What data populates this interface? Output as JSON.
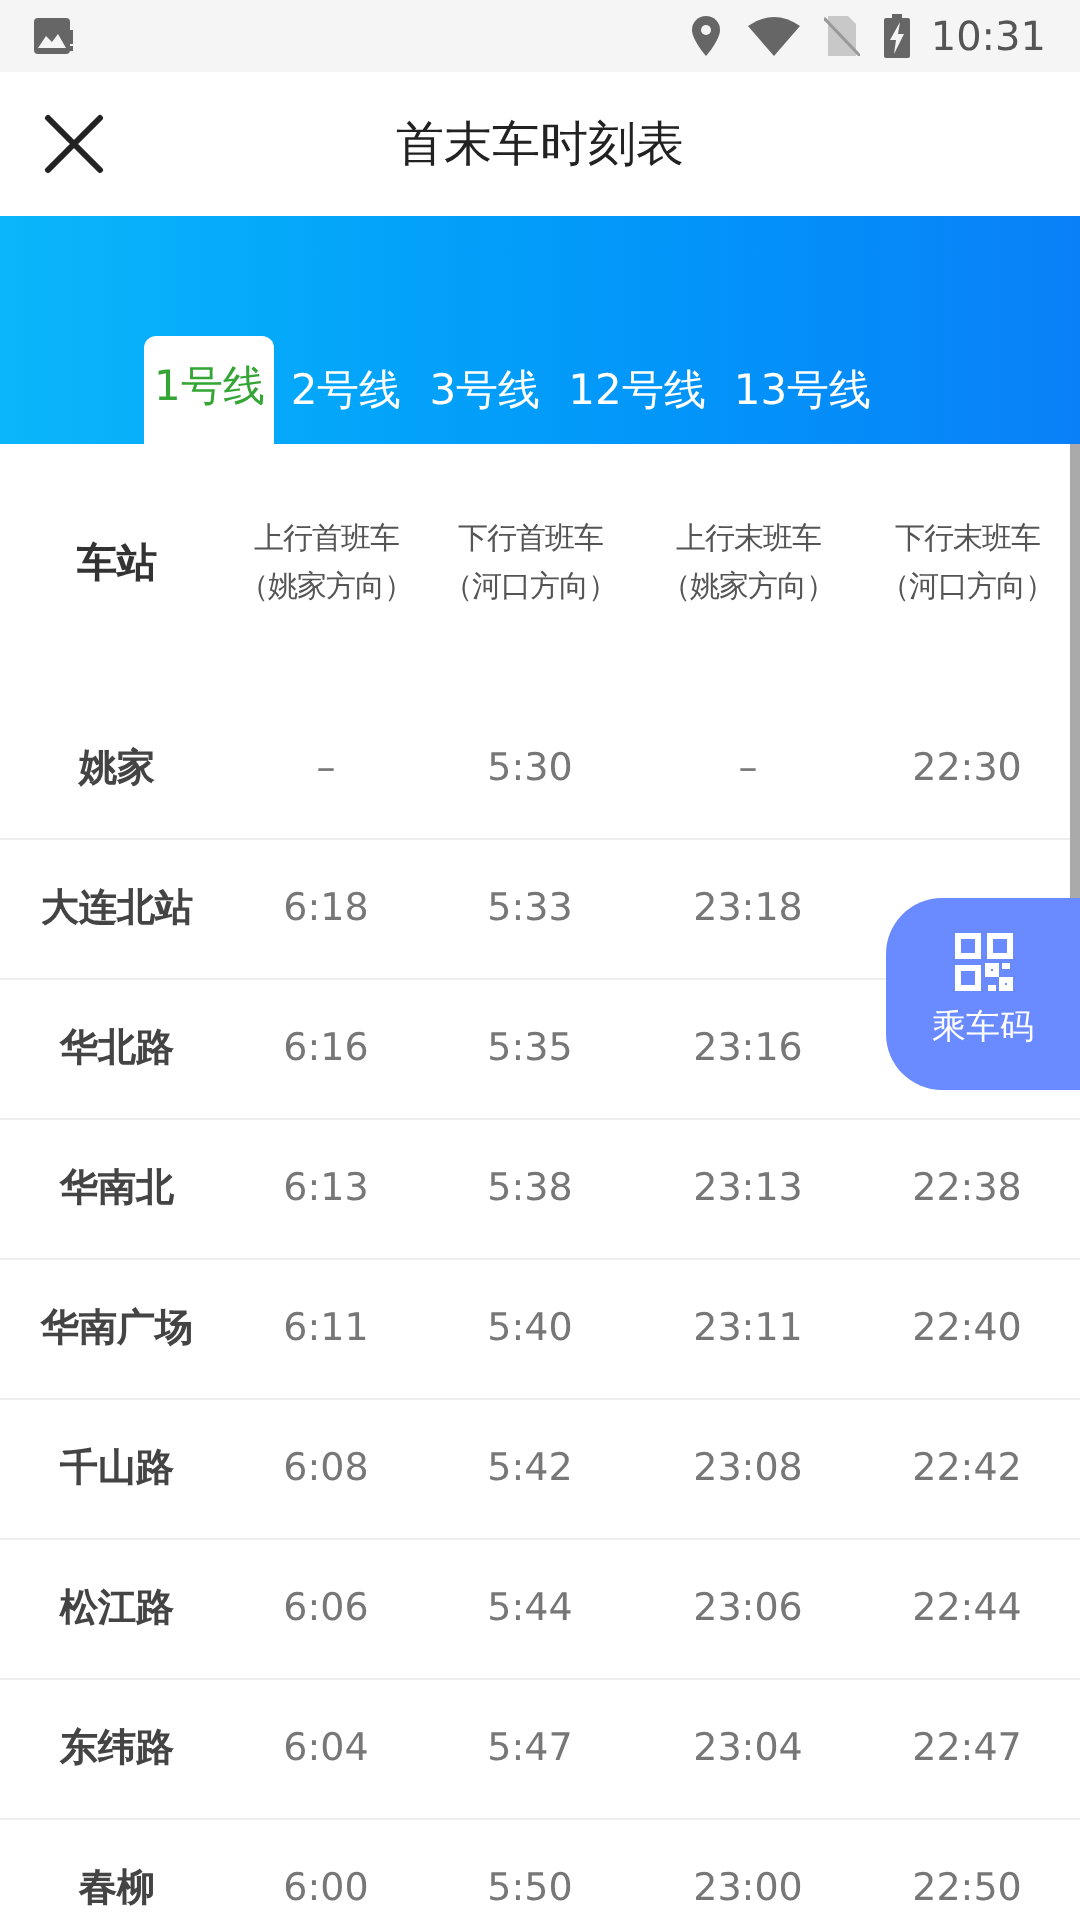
{
  "status_bar": {
    "time": "10:31"
  },
  "header": {
    "title": "首末车时刻表"
  },
  "tabs": [
    {
      "label": "1号线",
      "selected": true
    },
    {
      "label": "2号线",
      "selected": false
    },
    {
      "label": "3号线",
      "selected": false
    },
    {
      "label": "12号线",
      "selected": false
    },
    {
      "label": "13号线",
      "selected": false
    }
  ],
  "table": {
    "columns": [
      {
        "title": "车站"
      },
      {
        "title": "上行首班车",
        "subtitle": "（姚家方向）"
      },
      {
        "title": "下行首班车",
        "subtitle": "（河口方向）"
      },
      {
        "title": "上行末班车",
        "subtitle": "（姚家方向）"
      },
      {
        "title": "下行末班车",
        "subtitle": "（河口方向）"
      }
    ],
    "rows": [
      {
        "station": "姚家",
        "times": [
          "–",
          "5:30",
          "–",
          "22:30"
        ]
      },
      {
        "station": "大连北站",
        "times": [
          "6:18",
          "5:33",
          "23:18"
        ]
      },
      {
        "station": "华北路",
        "times": [
          "6:16",
          "5:35",
          "23:16"
        ]
      },
      {
        "station": "华南北",
        "times": [
          "6:13",
          "5:38",
          "23:13",
          "22:38"
        ]
      },
      {
        "station": "华南广场",
        "times": [
          "6:11",
          "5:40",
          "23:11",
          "22:40"
        ]
      },
      {
        "station": "千山路",
        "times": [
          "6:08",
          "5:42",
          "23:08",
          "22:42"
        ]
      },
      {
        "station": "松江路",
        "times": [
          "6:06",
          "5:44",
          "23:06",
          "22:44"
        ]
      },
      {
        "station": "东纬路",
        "times": [
          "6:04",
          "5:47",
          "23:04",
          "22:47"
        ]
      },
      {
        "station": "春柳",
        "times": [
          "6:00",
          "5:50",
          "23:00",
          "22:50"
        ]
      }
    ]
  },
  "fab": {
    "label": "乘车码"
  }
}
